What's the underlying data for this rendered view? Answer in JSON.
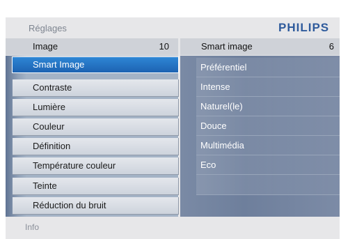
{
  "header": {
    "title": "Réglages",
    "brand": "PHILIPS"
  },
  "left_column": {
    "title": "Image",
    "count": "10",
    "items": [
      {
        "label": "Smart Image",
        "selected": true
      },
      {
        "label": "Contraste"
      },
      {
        "label": "Lumière"
      },
      {
        "label": "Couleur"
      },
      {
        "label": "Définition"
      },
      {
        "label": "Température couleur"
      },
      {
        "label": "Teinte"
      },
      {
        "label": "Réduction du bruit"
      }
    ]
  },
  "right_column": {
    "title": "Smart image",
    "count": "6",
    "items": [
      {
        "label": "Préférentiel"
      },
      {
        "label": "Intense"
      },
      {
        "label": "Naturel(le)"
      },
      {
        "label": "Douce"
      },
      {
        "label": "Multimédia"
      },
      {
        "label": "Eco"
      }
    ]
  },
  "footer": {
    "info": "Info"
  },
  "colors": {
    "selected": "#1f6fc2",
    "brand": "#2f5b9c"
  }
}
